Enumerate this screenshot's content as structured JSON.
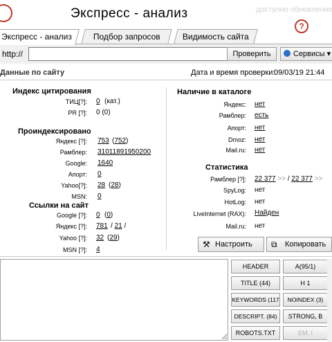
{
  "app": {
    "title": "Экспресс - анализ",
    "update_note": "доступно обновление",
    "help_glyph": "?"
  },
  "tabs": [
    {
      "label": "Экспресс - анализ",
      "active": true
    },
    {
      "label": "Подбор запросов",
      "active": false
    },
    {
      "label": "Видимость сайта",
      "active": false
    }
  ],
  "toolbar": {
    "url_prefix": "http://",
    "url_value": "",
    "check_label": "Проверить",
    "services_label": "Сервисы ▾"
  },
  "section": {
    "title": "Данные по сайту",
    "check_time_label": "Дата и время проверки:",
    "check_time_value": "09/03/19 21:44"
  },
  "left": {
    "citation_header": "Индекс цитирования",
    "tic_label": "ТИЦ[?]:",
    "tic_value": "0",
    "tic_suffix": "(кат.)",
    "pr_label": "PR [?]:",
    "pr_value": "0 (0)",
    "indexed_header": "Проиндексировано",
    "indexed": [
      {
        "label": "Яндекс [?]:",
        "value": "753",
        "extra": "752"
      },
      {
        "label": "Рамблер:",
        "value": "31011891950200",
        "extra": ""
      },
      {
        "label": "Google:",
        "value": "1640",
        "extra": ""
      },
      {
        "label": "Апорт:",
        "value": "0",
        "extra": ""
      },
      {
        "label": "Yahoo[?]:",
        "value": "28",
        "extra": "28"
      },
      {
        "label": "MSN:",
        "value": "0",
        "extra": ""
      }
    ],
    "links_header": "Ссылки на сайт",
    "links": [
      {
        "label": "Google [?]:",
        "value": "0",
        "extra": "0"
      },
      {
        "label": "Яндекс [?]:",
        "value": "781",
        "extra": "21"
      },
      {
        "label": "Yahoo [?]:",
        "value": "32",
        "extra": "29"
      },
      {
        "label": "MSN [?]:",
        "value": "4",
        "extra": ""
      }
    ]
  },
  "right": {
    "catalog_header": "Наличие в каталоге",
    "catalog": [
      {
        "label": "Яндекс:",
        "value": "нет"
      },
      {
        "label": "Рамблер:",
        "value": "есть"
      },
      {
        "label": "Апорт:",
        "value": "нет"
      },
      {
        "label": "Dmoz:",
        "value": "нет"
      },
      {
        "label": "Mail.ru:",
        "value": "нет"
      }
    ],
    "stats_header": "Статистика",
    "rambler_label": "Рамблер [?]:",
    "rambler_value1": "22 377",
    "rambler_arrow1": ">>",
    "rambler_sep": "/",
    "rambler_value2": "22 377",
    "rambler_arrow2": ">>",
    "stats": [
      {
        "label": "SpyLog:",
        "value": "нет"
      },
      {
        "label": "HotLog:",
        "value": "нет"
      },
      {
        "label": "LiveInternet (RAX):",
        "value": "Найден"
      },
      {
        "label": "Mail.ru:",
        "value": "нет"
      }
    ],
    "setup_label": "Настроить",
    "copy_label": "Копировать"
  },
  "tag_buttons": {
    "header": "HEADER",
    "a": "A(95/1)",
    "title": "TITLE (44)",
    "h1": "H 1",
    "keywords": "KEYWORDS (117",
    "noindex": "NOINDEX  (3)",
    "descript": "DESCRIPT. (84)",
    "strong": "STRONG, B",
    "robots": "ROBOTS.TXT",
    "em": "EM, I"
  }
}
